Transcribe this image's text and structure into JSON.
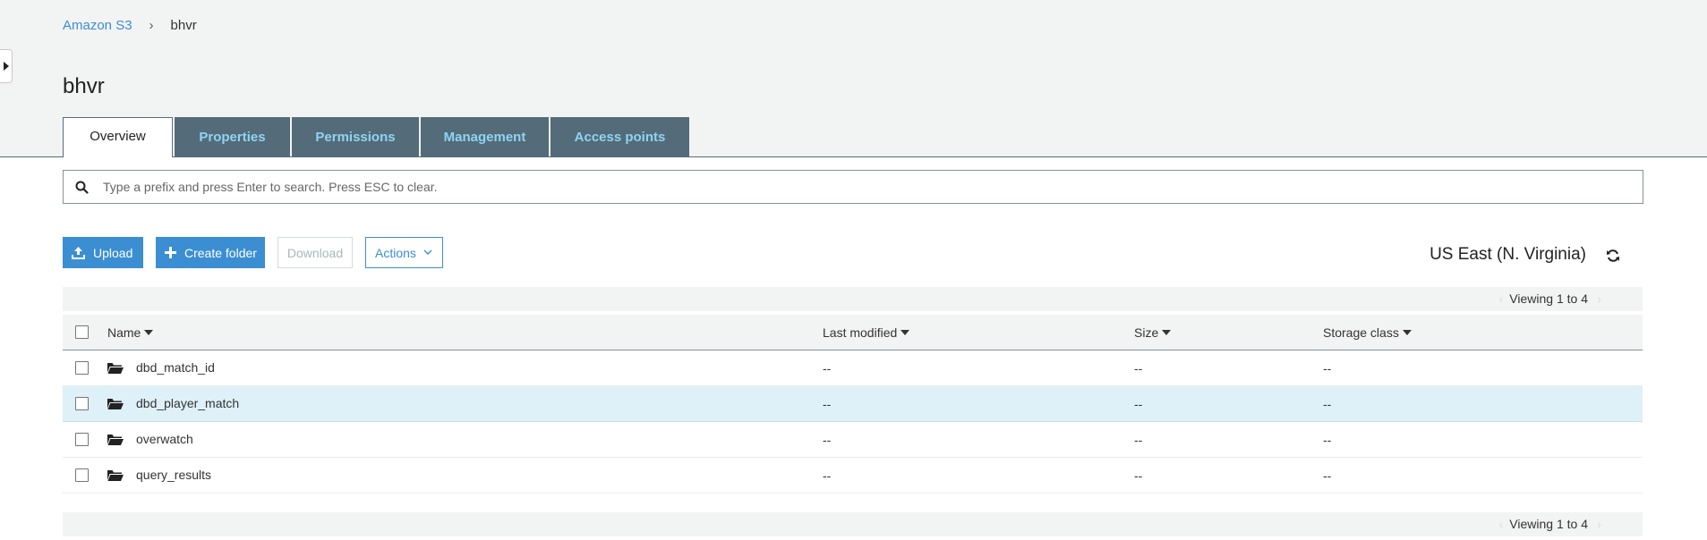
{
  "breadcrumb": {
    "root": "Amazon S3",
    "separator": "›",
    "current": "bhvr"
  },
  "page": {
    "title": "bhvr"
  },
  "tabs": [
    {
      "label": "Overview",
      "active": true
    },
    {
      "label": "Properties",
      "active": false
    },
    {
      "label": "Permissions",
      "active": false
    },
    {
      "label": "Management",
      "active": false
    },
    {
      "label": "Access points",
      "active": false
    }
  ],
  "search": {
    "placeholder": "Type a prefix and press Enter to search. Press ESC to clear.",
    "value": ""
  },
  "toolbar": {
    "upload_label": "Upload",
    "create_folder_label": "Create folder",
    "download_label": "Download",
    "actions_label": "Actions",
    "region": "US East (N. Virginia)"
  },
  "pagination": {
    "top": "Viewing 1 to 4",
    "bottom": "Viewing 1 to 4"
  },
  "table": {
    "columns": {
      "name": "Name",
      "last_modified": "Last modified",
      "size": "Size",
      "storage_class": "Storage class"
    },
    "rows": [
      {
        "name": "dbd_match_id",
        "last_modified": "--",
        "size": "--",
        "storage_class": "--",
        "selected": false
      },
      {
        "name": "dbd_player_match",
        "last_modified": "--",
        "size": "--",
        "storage_class": "--",
        "selected": true
      },
      {
        "name": "overwatch",
        "last_modified": "--",
        "size": "--",
        "storage_class": "--",
        "selected": false
      },
      {
        "name": "query_results",
        "last_modified": "--",
        "size": "--",
        "storage_class": "--",
        "selected": false
      }
    ]
  },
  "colors": {
    "accent": "#3b8ed1",
    "tab_background": "#546b7a",
    "tab_text": "#8fd4f2",
    "selected_row": "#def0f8",
    "band_background": "#f2f3f3"
  },
  "icons": {
    "sidebar_toggle": "caret-right-icon",
    "search": "search-icon",
    "upload": "upload-icon",
    "create_folder": "plus-icon",
    "actions": "chevron-down-icon",
    "refresh": "refresh-icon",
    "folder": "folder-open-icon",
    "sort": "caret-down-icon"
  }
}
